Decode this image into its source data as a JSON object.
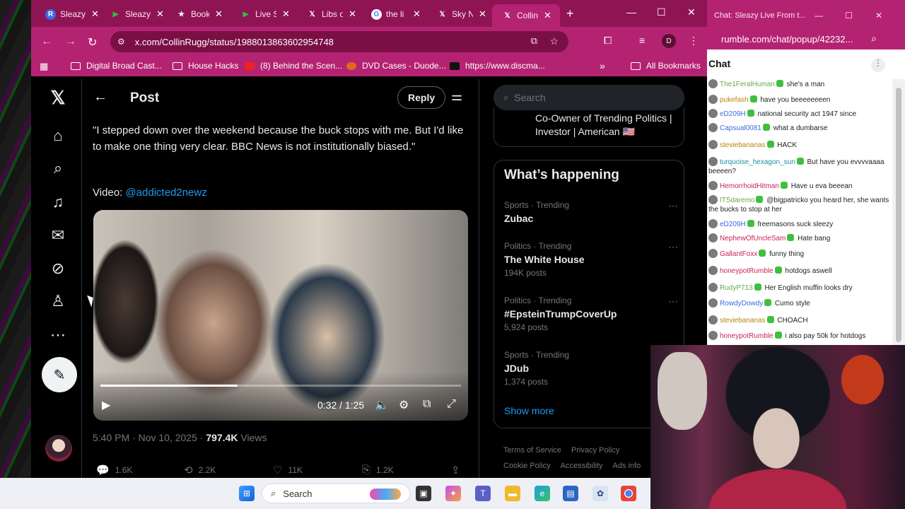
{
  "browser": {
    "tabs": [
      {
        "label": "Sleazy",
        "icon": "rumble-icon",
        "icon_char": "R",
        "icon_color": "#3b6be0"
      },
      {
        "label": "Sleazy",
        "icon": "rumble-play-icon",
        "icon_char": "▶",
        "icon_color": "#2fbf3f"
      },
      {
        "label": "Bookmarks",
        "icon": "star-icon",
        "icon_char": "★",
        "icon_color": "#8f1454"
      },
      {
        "label": "Live S",
        "icon": "rumble-play-icon",
        "icon_char": "▶",
        "icon_color": "#2fbf3f"
      },
      {
        "label": "Libs of",
        "icon": "x-logo-icon",
        "icon_char": "𝕏",
        "icon_color": "#8f1454"
      },
      {
        "label": "the li",
        "icon": "google-icon",
        "icon_char": "G",
        "icon_color": "#ffffff"
      },
      {
        "label": "Sky N",
        "icon": "x-logo-icon",
        "icon_char": "𝕏",
        "icon_color": "#8f1454"
      },
      {
        "label": "Collin",
        "icon": "x-logo-icon",
        "icon_char": "𝕏",
        "icon_color": "#b42372",
        "active": true
      }
    ],
    "url": "x.com/CollinRugg/status/1988013863602954748",
    "profile_initial": "D",
    "bookmarks": [
      {
        "label": "Digital Broad Cast...",
        "type": "folder"
      },
      {
        "label": "House Hacks",
        "type": "folder"
      },
      {
        "label": "(8) Behind the Scen...",
        "type": "youtube"
      },
      {
        "label": "DVD Cases - Duode...",
        "type": "site"
      },
      {
        "label": "https://www.discma...",
        "type": "page"
      },
      {
        "label": "All Bookmarks",
        "type": "folder"
      }
    ]
  },
  "x": {
    "header_title": "Post",
    "reply_label": "Reply",
    "quote": "\"I stepped down over the weekend because the buck stops with me. But I'd like to make one thing very clear. BBC News is not institutionally biased.\"",
    "video_prefix": "Video: ",
    "video_handle": "@addicted2newz",
    "video": {
      "time": "0:32 / 1:25",
      "progress": 0.38
    },
    "meta_time": "5:40 PM · Nov 10, 2025 · ",
    "meta_views": "797.4K",
    "meta_views_label": " Views",
    "engagement": {
      "replies": "1.6K",
      "reposts": "2.2K",
      "likes": "11K",
      "bookmarks": "1.2K"
    },
    "search_placeholder": "Search",
    "who_bio": "Co-Owner of Trending Politics | Investor | American 🇺🇸",
    "happening_title": "What’s happening",
    "trends": [
      {
        "context": "Sports · Trending",
        "name": "Zubac",
        "count": ""
      },
      {
        "context": "Politics · Trending",
        "name": "The White House",
        "count": "194K posts"
      },
      {
        "context": "Politics · Trending",
        "name": "#EpsteinTrumpCoverUp",
        "count": "5,924 posts"
      },
      {
        "context": "Sports · Trending",
        "name": "JDub",
        "count": "1,374 posts"
      }
    ],
    "show_more": "Show more",
    "footer": {
      "terms": "Terms of Service",
      "privacy": "Privacy Policy",
      "cookie": "Cookie Policy",
      "access": "Accessibility",
      "ads": "Ads info"
    }
  },
  "chat": {
    "window_title": "Chat: Sleazy Live From t...",
    "url": "rumble.com/chat/popup/42232...",
    "title": "Chat",
    "messages": [
      {
        "user": "The1FeralHuman",
        "color": "#6aa84f",
        "text": "she's a man"
      },
      {
        "user": "pukefash",
        "color": "#b8860b",
        "text": "have you beeeeeeeen"
      },
      {
        "user": "eD209H",
        "color": "#3b6be0",
        "text": "national security act 1947 since"
      },
      {
        "user": "Capsual0081",
        "color": "#3b6be0",
        "text": "what a dumbarse"
      },
      {
        "user": "steviebananas",
        "color": "#b8860b",
        "text": "HACK"
      },
      {
        "user": "turquoise_hexagon_sun",
        "color": "#1a8fa0",
        "text": "But have you evvvvaaaa beeeen?"
      },
      {
        "user": "HemorrhoidHitman",
        "color": "#cc2255",
        "text": "Have u eva beeean"
      },
      {
        "user": "ITSdaremo",
        "color": "#6aa84f",
        "text": "@bigpatricko you heard her, she wants the bucks to stop at her"
      },
      {
        "user": "eD209H",
        "color": "#3b6be0",
        "text": "freemasons suck sleezy"
      },
      {
        "user": "NephewOfUncleSam",
        "color": "#cc2255",
        "text": "Hate bang"
      },
      {
        "user": "GallantFoxx",
        "color": "#cc2255",
        "text": "funny thing"
      },
      {
        "user": "honeypotRumble",
        "color": "#cc2255",
        "text": "hotdogs aswell"
      },
      {
        "user": "RudyP713",
        "color": "#6aa84f",
        "text": "Her English muffin looks dry"
      },
      {
        "user": "RowdyDowdy",
        "color": "#3b6be0",
        "text": "Cumo style"
      },
      {
        "user": "steviebananas",
        "color": "#b8860b",
        "text": "CHOACH"
      },
      {
        "user": "honeypotRumble",
        "color": "#cc2255",
        "text": "i also pay 50k for hotdogs"
      }
    ]
  },
  "taskbar": {
    "search": "Search"
  }
}
